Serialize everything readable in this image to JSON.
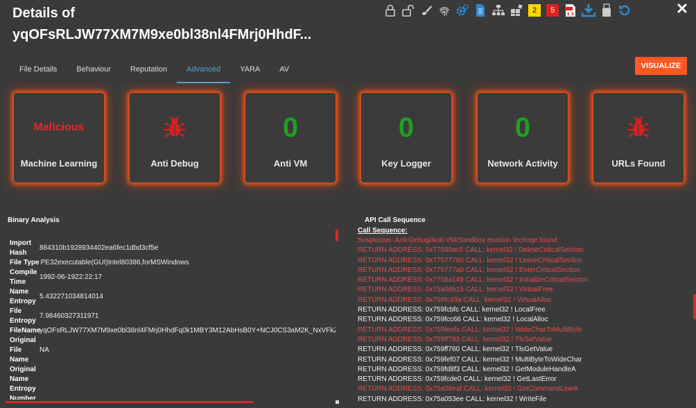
{
  "header": {
    "title": "Details of yqOFsRLJW77XM7M9xe0bl38nl4FMrj0HhdF...",
    "badges": [
      {
        "label": "2",
        "bg": "#ffd600",
        "fg": "#000000"
      },
      {
        "label": "5",
        "bg": "#e0201b",
        "fg": "#ffffff"
      }
    ],
    "toolbar_icons": [
      "lock-icon",
      "unlock-icon",
      "brush-icon",
      "fingerprint-icon",
      "gears-icon",
      "document-icon",
      "network-icon",
      "puzzle-icon",
      "pdf-icon",
      "download-icon",
      "usb-icon",
      "refresh-icon"
    ]
  },
  "tabs": [
    {
      "label": "File Details"
    },
    {
      "label": "Behaviour"
    },
    {
      "label": "Reputation"
    },
    {
      "label": "Advanced",
      "active": true
    },
    {
      "label": "YARA"
    },
    {
      "label": "AV"
    }
  ],
  "visualize_label": "VISUALIZE",
  "cards": [
    {
      "label": "Machine Learning",
      "value": "Malicious",
      "kind": "text",
      "color": "#e12a2a"
    },
    {
      "label": "Anti Debug",
      "kind": "bug-icon",
      "color": "#d4221f"
    },
    {
      "label": "Anti VM",
      "value": "0",
      "kind": "number",
      "color": "#1fa01f"
    },
    {
      "label": "Key Logger",
      "value": "0",
      "kind": "number",
      "color": "#1fa01f"
    },
    {
      "label": "Network Activity",
      "value": "0",
      "kind": "number",
      "color": "#1fa01f"
    },
    {
      "label": "URLs Found",
      "kind": "bug-icon",
      "color": "#d4221f"
    }
  ],
  "binary_analysis": {
    "title": "Binary Analysis",
    "rows": [
      {
        "key": "Import Hash",
        "value": "884310b1928934402ea6fec1dbd3cf5e"
      },
      {
        "key": "File Type",
        "value": "PE32executable(GUI)Intel80386,forMSWindows"
      },
      {
        "key": "Compile Time",
        "value": "1992-06-1922:22:17"
      },
      {
        "key": "Name Entropy",
        "value": "5.432271034814014"
      },
      {
        "key": "File Entropy",
        "value": "7.98460327311971"
      },
      {
        "key": "FileName",
        "value": "yqOFsRLJW77XM7M9xe0bl38nl4FMrj0HhdFq0k1MBY3M12AbHsB0Y+NCJ0CS3aM2K_NxVFkZ"
      },
      {
        "key": "Original File Name",
        "value": "NA"
      },
      {
        "key": "Original Name Entropy",
        "value": ""
      }
    ],
    "cut_key": "Number"
  },
  "api_calls": {
    "title": "API Call Sequence",
    "heading": "Call Sequence:",
    "lines": [
      {
        "text": "Suspicious: Anti-Debug/Anti-VM/Sandbox evasion technqe found",
        "suspicious": true
      },
      {
        "text": "RETURN ADDRESS: 0x77589ac5 CALL: kernel32 ! DeleteCriticalSection",
        "suspicious": true
      },
      {
        "text": "RETURN ADDRESS: 0x77577760 CALL: kernel32 ! LeaveCriticalSection",
        "suspicious": true
      },
      {
        "text": "RETURN ADDRESS: 0x775777a0 CALL: kernel32 ! EnterCriticalSection",
        "suspicious": true
      },
      {
        "text": "RETURN ADDRESS: 0x7758a149 CALL: kernel32 ! InitializeCriticalSection",
        "suspicious": true
      },
      {
        "text": "RETURN ADDRESS: 0x75a06b15 CALL: kernel32 ! VirtualFree",
        "suspicious": true
      },
      {
        "text": "RETURN ADDRESS: 0x759fc43a CALL: kernel32 ! VirtualAlloc",
        "suspicious": true
      },
      {
        "text": "RETURN ADDRESS: 0x759fcbfc CALL: kernel32 ! LocalFree",
        "suspicious": false
      },
      {
        "text": "RETURN ADDRESS: 0x759fcc66 CALL: kernel32 ! LocalAlloc",
        "suspicious": false
      },
      {
        "text": "RETURN ADDRESS: 0x759feefa CALL: kernel32 ! WideCharToMultiByte",
        "suspicious": true
      },
      {
        "text": "RETURN ADDRESS: 0x759ff783 CALL: kernel32 ! TlsSetValue",
        "suspicious": true
      },
      {
        "text": "RETURN ADDRESS: 0x759ff760 CALL: kernel32 ! TlsGetValue",
        "suspicious": false
      },
      {
        "text": "RETURN ADDRESS: 0x759fef07 CALL: kernel32 ! MultiByteToWideChar",
        "suspicious": false
      },
      {
        "text": "RETURN ADDRESS: 0x759fd8f3 CALL: kernel32 ! GetModuleHandleA",
        "suspicious": false
      },
      {
        "text": "RETURN ADDRESS: 0x759fcde0 CALL: kernel32 ! GetLastError",
        "suspicious": false
      },
      {
        "text": "RETURN ADDRESS: 0x75a08eaf CALL: kernel32 ! GetCommandLineA",
        "suspicious": true
      },
      {
        "text": "RETURN ADDRESS: 0x75a053ee CALL: kernel32 ! WriteFile",
        "suspicious": false
      }
    ]
  }
}
